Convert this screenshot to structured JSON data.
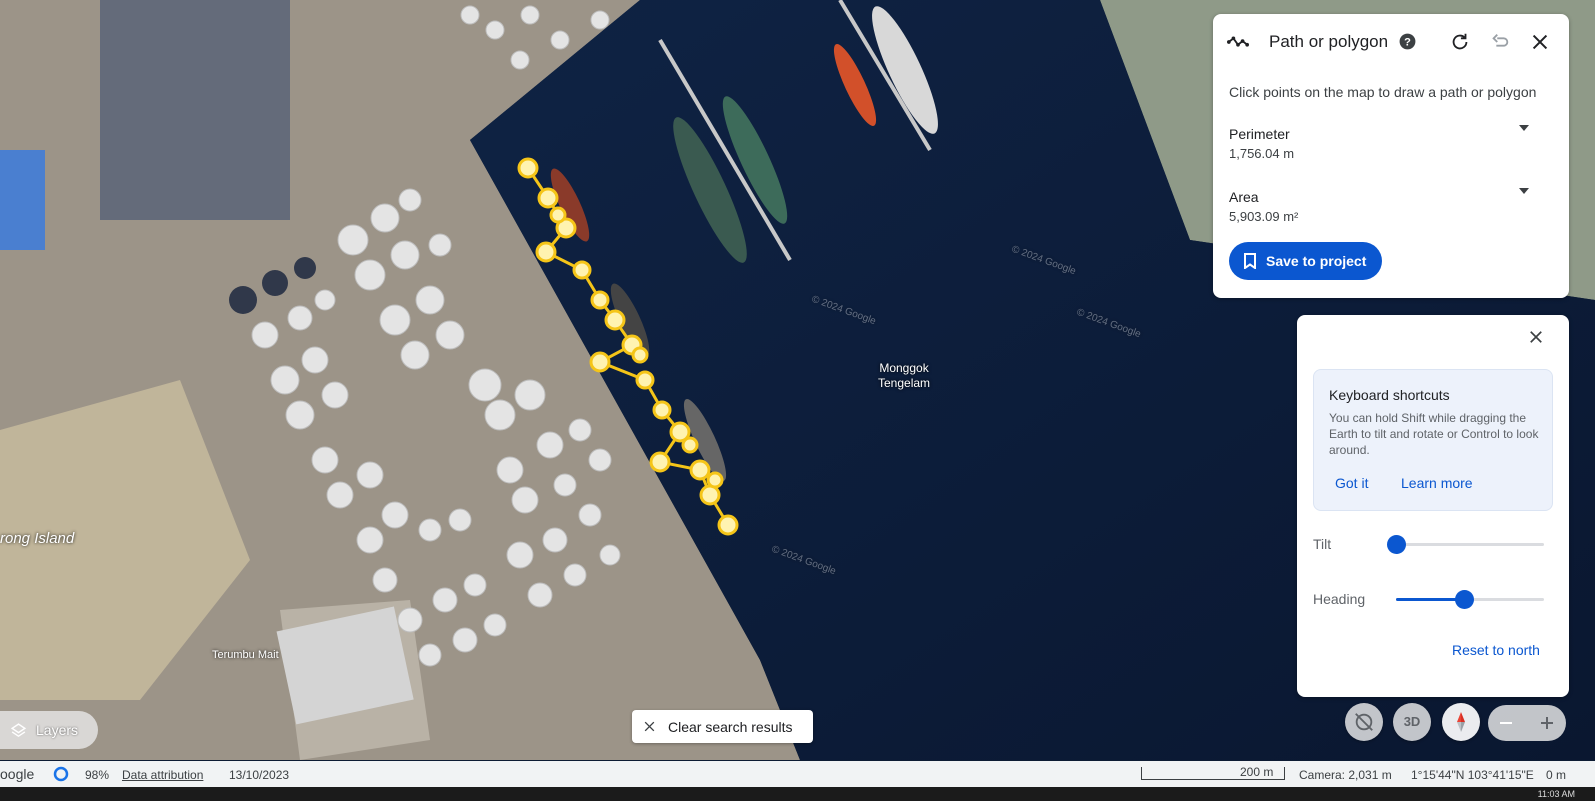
{
  "path_panel": {
    "title": "Path or polygon",
    "subtitle": "Click points on the map to draw a path or polygon",
    "perimeter_label": "Perimeter",
    "perimeter_value": "1,756.04 m",
    "area_label": "Area",
    "area_value": "5,903.09 m²",
    "save_label": "Save to project",
    "icons": [
      "path-icon",
      "help-icon",
      "refresh-icon",
      "undo-icon",
      "close-icon",
      "caret-down-icon",
      "bookmark-icon"
    ]
  },
  "settings_panel": {
    "kb_title": "Keyboard shortcuts",
    "kb_text": "You can hold Shift while dragging the Earth to tilt and rotate or Control to look around.",
    "got_it": "Got it",
    "learn_more": "Learn more",
    "tilt_label": "Tilt",
    "tilt_value": 0.0,
    "heading_label": "Heading",
    "heading_value": 0.46,
    "reset_north": "Reset to north"
  },
  "map_controls": {
    "three_d_label": "3D",
    "layers_label": "Layers",
    "clear_search": "Clear search results"
  },
  "map_labels": {
    "water_label": "Monggok\nTengelam",
    "island_label": "rong Island",
    "place_label": "Terumbu Mait",
    "watermark": "© 2024 Google"
  },
  "status_bar": {
    "brand": "oogle",
    "loading": "98%",
    "data_attribution": "Data attribution",
    "date": "13/10/2023",
    "scale": "200 m",
    "camera": "Camera: 2,031 m",
    "coords": "1°15'44\"N 103°41'15\"E",
    "elevation": "0 m"
  },
  "taskbar": {
    "time": "11:03 AM"
  },
  "colors": {
    "accent": "#0b57d0",
    "sea": "#0d1b33",
    "path": "#f5c518"
  }
}
